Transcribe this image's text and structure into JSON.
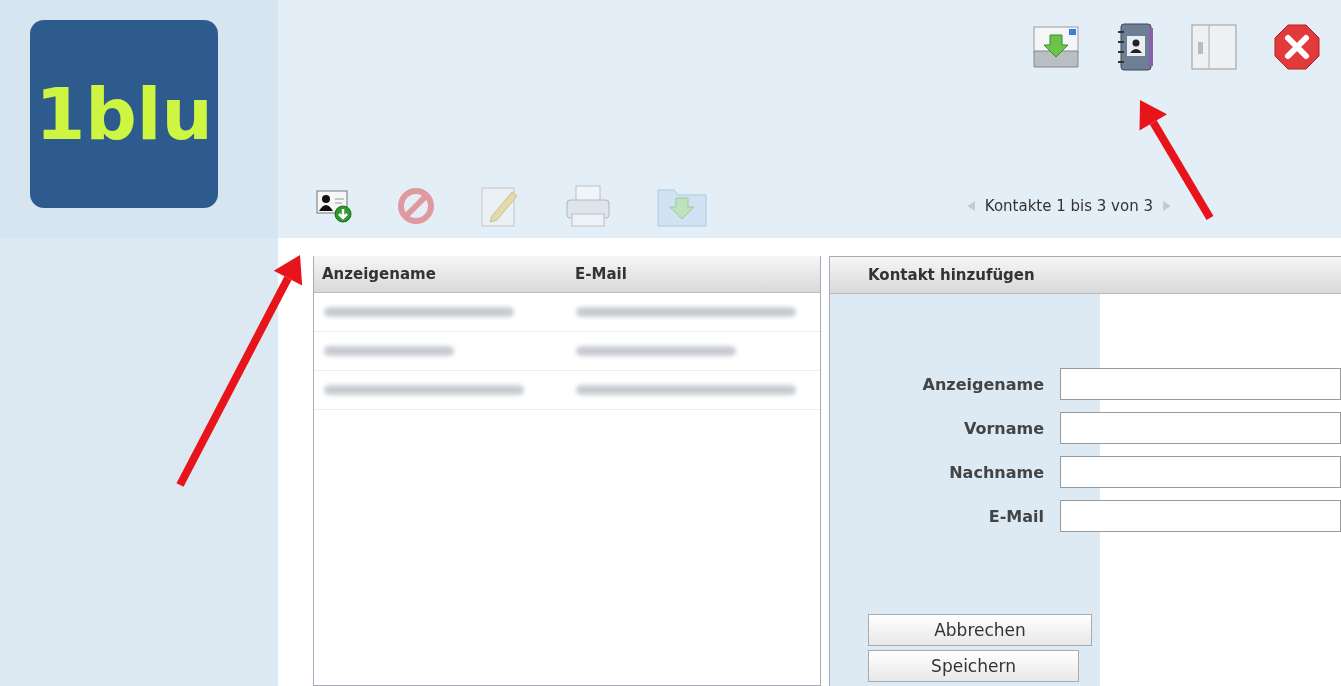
{
  "logo": {
    "text": "1blu"
  },
  "top_toolbar": [
    {
      "kind": "mail-import"
    },
    {
      "kind": "address-book"
    },
    {
      "kind": "notebook"
    },
    {
      "kind": "close"
    }
  ],
  "contact_toolbar": [
    {
      "kind": "add-contact",
      "disabled": false
    },
    {
      "kind": "delete",
      "disabled": true
    },
    {
      "kind": "edit",
      "disabled": true
    },
    {
      "kind": "print",
      "disabled": true
    },
    {
      "kind": "export",
      "disabled": true
    }
  ],
  "pager": {
    "text": "Kontakte 1 bis 3 von 3",
    "prev_disabled": true,
    "next_disabled": true
  },
  "contact_list": {
    "columns": [
      "Anzeigename",
      "E-Mail"
    ],
    "rows": [
      {
        "kind": "redacted"
      },
      {
        "kind": "redacted"
      },
      {
        "kind": "redacted"
      }
    ]
  },
  "contact_form": {
    "title": "Kontakt hinzufügen",
    "fields": [
      {
        "label": "Anzeigename"
      },
      {
        "label": "Vorname"
      },
      {
        "label": "Nachname"
      },
      {
        "label": "E-Mail"
      }
    ],
    "buttons": [
      "Abbrechen",
      "Speichern"
    ]
  },
  "annotations": [
    {
      "kind": "arrow"
    },
    {
      "kind": "arrow"
    }
  ]
}
